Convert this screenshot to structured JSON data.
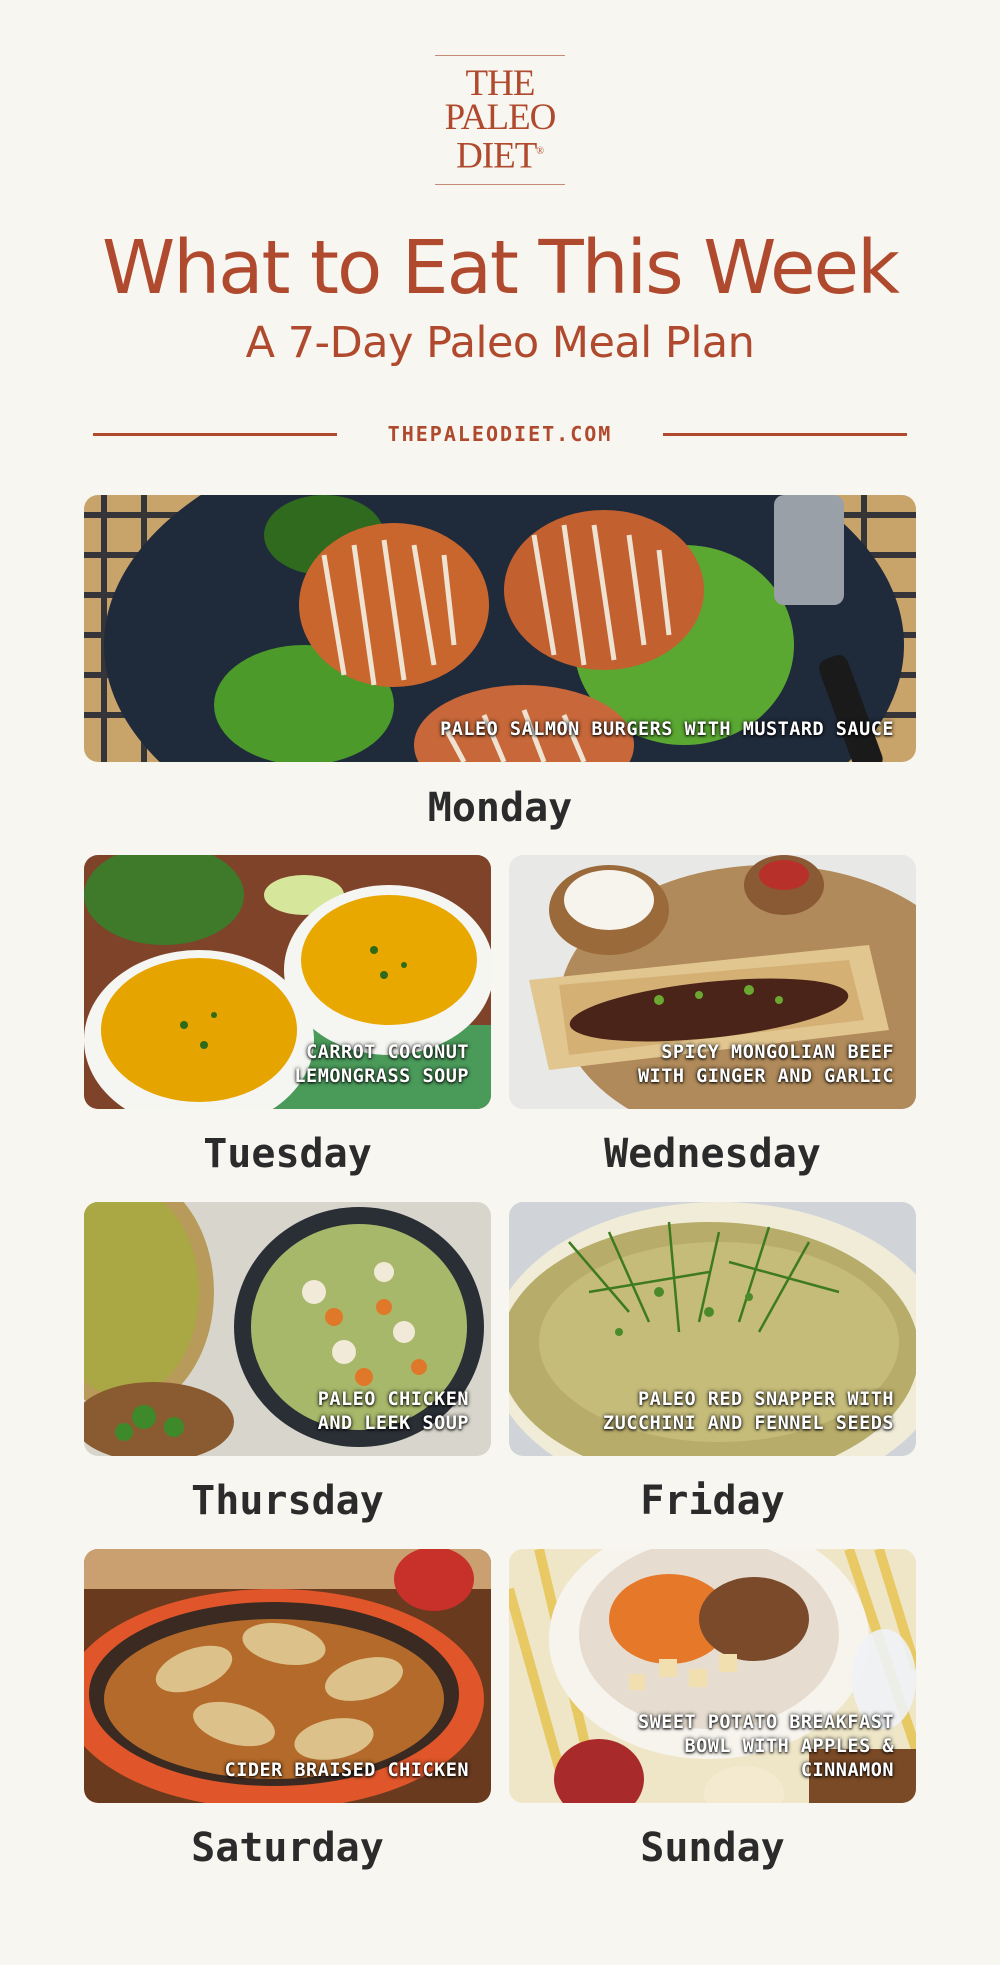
{
  "logo": {
    "line1": "THE",
    "line2": "PALEO",
    "line3": "DIET",
    "mark": "®"
  },
  "header": {
    "title": "What to Eat This Week",
    "subtitle": "A 7-Day Paleo Meal Plan",
    "site": "THEPALEODIET.COM"
  },
  "colors": {
    "brand": "#b04a2e",
    "background": "#f8f6f0",
    "day_text": "#2b2b2b"
  },
  "meals": [
    {
      "day": "Monday",
      "caption": [
        "PALEO SALMON BURGERS WITH MUSTARD SAUCE"
      ]
    },
    {
      "day": "Tuesday",
      "caption": [
        "CARROT COCONUT",
        "LEMONGRASS SOUP"
      ]
    },
    {
      "day": "Wednesday",
      "caption": [
        "SPICY MONGOLIAN BEEF",
        "WITH GINGER AND GARLIC"
      ]
    },
    {
      "day": "Thursday",
      "caption": [
        "PALEO CHICKEN",
        "AND LEEK SOUP"
      ]
    },
    {
      "day": "Friday",
      "caption": [
        "PALEO RED SNAPPER WITH",
        "ZUCCHINI AND FENNEL SEEDS"
      ]
    },
    {
      "day": "Saturday",
      "caption": [
        "CIDER BRAISED CHICKEN"
      ]
    },
    {
      "day": "Sunday",
      "caption": [
        "SWEET POTATO BREAKFAST",
        "BOWL WITH APPLES &",
        "CINNAMON"
      ]
    }
  ]
}
